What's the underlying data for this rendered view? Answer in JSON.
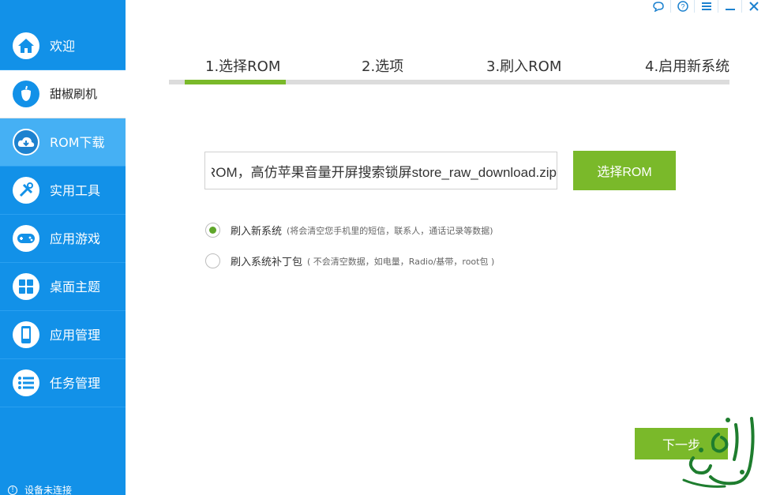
{
  "sidebar": {
    "items": [
      {
        "label": "欢迎",
        "icon": "home-icon"
      },
      {
        "label": "甜椒刷机",
        "icon": "pepper-refresh-icon"
      },
      {
        "label": "ROM下载",
        "icon": "cloud-download-icon"
      },
      {
        "label": "实用工具",
        "icon": "tools-icon"
      },
      {
        "label": "应用游戏",
        "icon": "gamepad-icon"
      },
      {
        "label": "桌面主题",
        "icon": "grid-icon"
      },
      {
        "label": "应用管理",
        "icon": "phone-icon"
      },
      {
        "label": "任务管理",
        "icon": "list-icon"
      }
    ],
    "status": "设备未连接"
  },
  "window_controls": [
    "chat-icon",
    "help-icon",
    "menu-icon",
    "minimize-icon",
    "close-icon"
  ],
  "steps": {
    "items": [
      "1.选择ROM",
      "2.选项",
      "3.刷入ROM",
      "4.启用新系统"
    ],
    "current": 1
  },
  "rom": {
    "path_value": "ROM，高仿苹果音量开屏搜索锁屏store_raw_download.zip",
    "select_button": "选择ROM"
  },
  "options": [
    {
      "label": "刷入新系统",
      "note": "(将会清空您手机里的短信，联系人，通话记录等数据)",
      "selected": true
    },
    {
      "label": "刷入系统补丁包",
      "note": "( 不会清空数据，如电量，Radio/基带，root包 )",
      "selected": false
    }
  ],
  "next_button": "下一步",
  "colors": {
    "sidebar": "#1291e8",
    "accent_green": "#7ab92a",
    "active_item": "#45b0f4"
  }
}
